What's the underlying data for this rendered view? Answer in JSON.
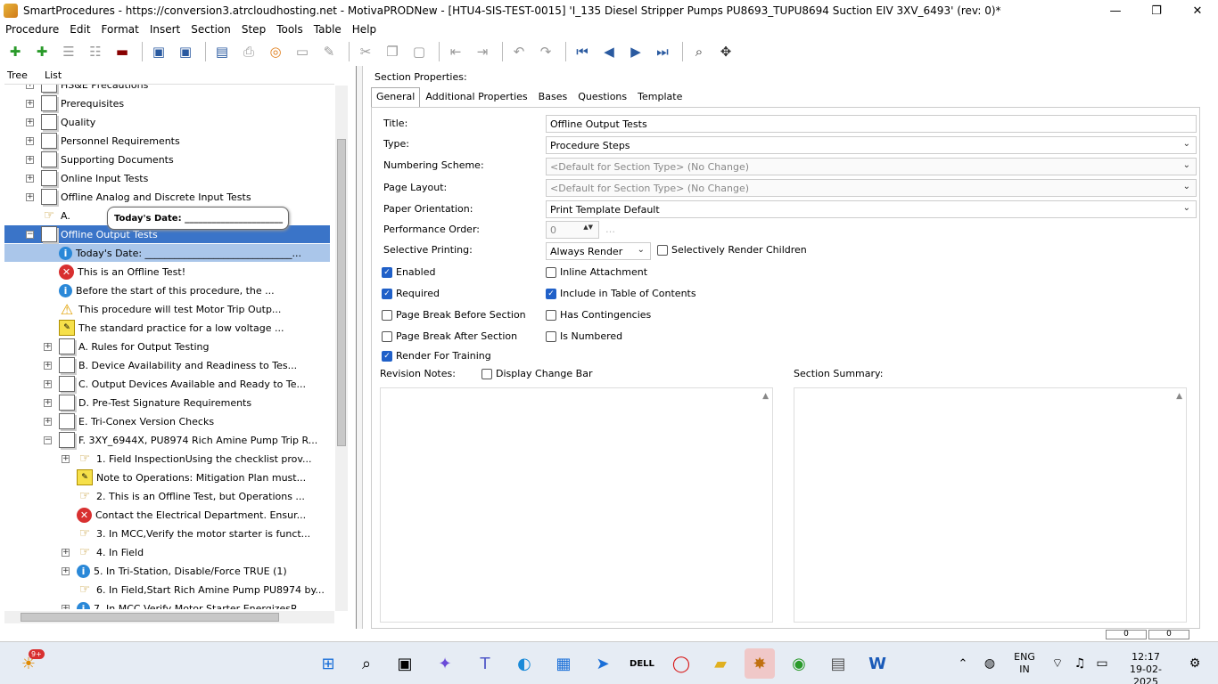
{
  "window": {
    "title": "SmartProcedures - https://conversion3.atrcloudhosting.net - MotivaPRODNew - [HTU4-SIS-TEST-0015] 'I_135 Diesel Stripper Pumps PU8693_TUPU8694 Suction EIV 3XV_6493' (rev: 0)*",
    "minimize": "—",
    "restore": "❐",
    "close": "✕"
  },
  "menu": [
    "Procedure",
    "Edit",
    "Format",
    "Insert",
    "Section",
    "Step",
    "Tools",
    "Table",
    "Help"
  ],
  "left_tabs": {
    "tree": "Tree",
    "list": "List"
  },
  "tree": [
    {
      "label": "HS&E Precautions",
      "level": 0,
      "expander": "+",
      "icon": "doc"
    },
    {
      "label": "Prerequisites",
      "level": 0,
      "expander": "+",
      "icon": "doc"
    },
    {
      "label": "Quality",
      "level": 0,
      "expander": "+",
      "icon": "doc"
    },
    {
      "label": "Personnel Requirements",
      "level": 0,
      "expander": "+",
      "icon": "doc"
    },
    {
      "label": "Supporting Documents",
      "level": 0,
      "expander": "+",
      "icon": "doc"
    },
    {
      "label": "Online Input Tests",
      "level": 0,
      "expander": "+",
      "icon": "doc"
    },
    {
      "label": "Offline Analog and Discrete Input Tests",
      "level": 0,
      "expander": "+",
      "icon": "doc"
    },
    {
      "label": "A.",
      "level": 0,
      "expander": "",
      "icon": "hand"
    },
    {
      "label": "Offline Output Tests",
      "level": 0,
      "expander": "−",
      "icon": "doc",
      "state": "selected"
    },
    {
      "label": "Today's Date: ______________________________...",
      "level": 1,
      "expander": "",
      "icon": "info",
      "state": "highlight"
    },
    {
      "label": "This is an Offline Test!",
      "level": 1,
      "expander": "",
      "icon": "err"
    },
    {
      "label": "Before the start of this procedure, the ...",
      "level": 1,
      "expander": "",
      "icon": "info"
    },
    {
      "label": "This procedure will test Motor Trip Outp...",
      "level": 1,
      "expander": "",
      "icon": "warn"
    },
    {
      "label": "The standard practice for a low voltage ...",
      "level": 1,
      "expander": "",
      "icon": "note"
    },
    {
      "label": "A. Rules for Output Testing",
      "level": 1,
      "expander": "+",
      "icon": "doc"
    },
    {
      "label": "B. Device Availability and Readiness to Tes...",
      "level": 1,
      "expander": "+",
      "icon": "doc"
    },
    {
      "label": "C. Output Devices Available and Ready to Te...",
      "level": 1,
      "expander": "+",
      "icon": "doc"
    },
    {
      "label": "D. Pre-Test Signature Requirements",
      "level": 1,
      "expander": "+",
      "icon": "doc"
    },
    {
      "label": "E. Tri-Conex Version Checks",
      "level": 1,
      "expander": "+",
      "icon": "doc"
    },
    {
      "label": "F. 3XY_6944X, PU8974 Rich Amine Pump Trip R...",
      "level": 1,
      "expander": "−",
      "icon": "doc"
    },
    {
      "label": "1. Field InspectionUsing the checklist prov...",
      "level": 2,
      "expander": "+",
      "icon": "hand"
    },
    {
      "label": "Note to Operations: Mitigation Plan must...",
      "level": 2,
      "expander": "",
      "icon": "note"
    },
    {
      "label": "2. This is an Offline Test, but Operations ...",
      "level": 2,
      "expander": "",
      "icon": "hand"
    },
    {
      "label": "Contact the Electrical Department. Ensur...",
      "level": 2,
      "expander": "",
      "icon": "err"
    },
    {
      "label": "3. In MCC,Verify the motor starter is funct...",
      "level": 2,
      "expander": "",
      "icon": "hand"
    },
    {
      "label": "4. In Field",
      "level": 2,
      "expander": "+",
      "icon": "hand"
    },
    {
      "label": "5. In Tri-Station, Disable/Force TRUE (1)",
      "level": 2,
      "expander": "+",
      "icon": "info"
    },
    {
      "label": "6. In Field,Start Rich Amine Pump PU8974 by...",
      "level": 2,
      "expander": "",
      "icon": "hand"
    },
    {
      "label": "7. In MCC,Verify Motor Starter EnergizesR...",
      "level": 2,
      "expander": "+",
      "icon": "info"
    }
  ],
  "tooltip": "Today's Date: ______________________",
  "section_properties": {
    "heading": "Section Properties:",
    "tabs": [
      "General",
      "Additional Properties",
      "Bases",
      "Questions",
      "Template"
    ],
    "title_label": "Title:",
    "title_value": "Offline Output Tests",
    "type_label": "Type:",
    "type_value": "Procedure Steps",
    "numbering_label": "Numbering Scheme:",
    "numbering_value": "<Default for Section Type> (No Change)",
    "layout_label": "Page Layout:",
    "layout_value": "<Default for Section Type> (No Change)",
    "orientation_label": "Paper Orientation:",
    "orientation_value": "Print Template Default",
    "perf_label": "Performance Order:",
    "perf_value": "0",
    "selective_label": "Selective Printing:",
    "selective_value": "Always Render",
    "checkboxes": [
      {
        "label": "Selectively Render Children",
        "checked": false
      },
      {
        "label": "Enabled",
        "checked": true
      },
      {
        "label": "Inline Attachment",
        "checked": false
      },
      {
        "label": "Required",
        "checked": true
      },
      {
        "label": "Include in Table of Contents",
        "checked": true
      },
      {
        "label": "Page Break Before Section",
        "checked": false
      },
      {
        "label": "Has Contingencies",
        "checked": false
      },
      {
        "label": "Page Break After Section",
        "checked": false
      },
      {
        "label": "Is Numbered",
        "checked": false
      },
      {
        "label": "Render For Training",
        "checked": true
      },
      {
        "label": "Display Change Bar",
        "checked": false
      }
    ],
    "revision_label": "Revision Notes:",
    "summary_label": "Section Summary:"
  },
  "status": [
    "0",
    "0"
  ],
  "taskbar": {
    "weather_badge": "9+",
    "lang": "ENG",
    "region": "IN",
    "time": "12:17",
    "date": "19-02-2025"
  }
}
